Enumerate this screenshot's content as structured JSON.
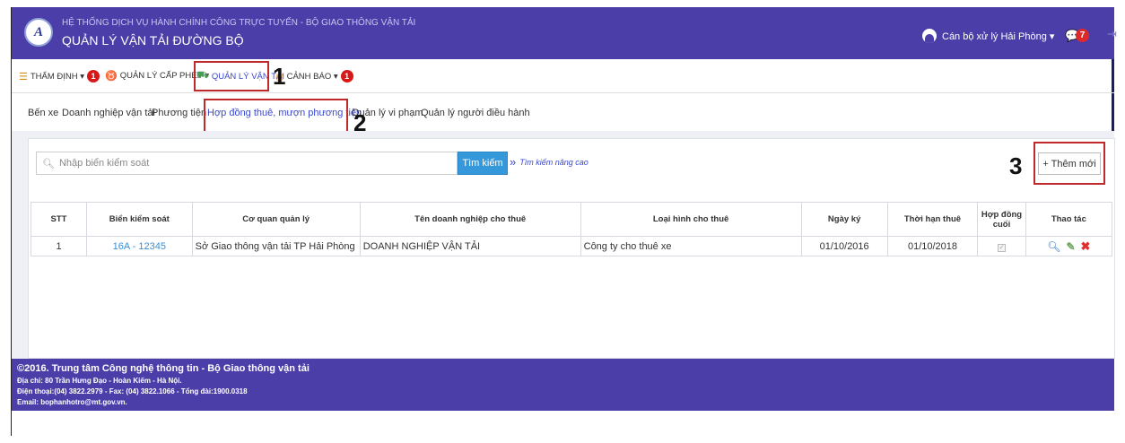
{
  "header": {
    "logo_text": "A",
    "subtitle": "HỆ THỐNG DỊCH VỤ HÀNH CHÍNH CÔNG TRỰC TUYẾN - BỘ GIAO THÔNG VẬN TẢI",
    "title": "QUẢN LÝ VẬN TẢI ĐƯỜNG BỘ",
    "user_label": "Cán bộ xử lý Hải Phòng ▾",
    "notification_count": "7"
  },
  "menu": {
    "items": [
      {
        "label": "THẨM ĐỊNH ▾",
        "badge": "1"
      },
      {
        "label": "QUẢN LÝ CẤP PHÉP ▾"
      },
      {
        "label": "QUẢN LÝ VẬN TẢI"
      },
      {
        "label": "CẢNH BÁO ▾",
        "badge": "1"
      }
    ]
  },
  "submenu": {
    "items": [
      "Bến xe",
      "Doanh nghiệp vận tải",
      "Phương tiện",
      "Hợp đồng thuê, mượn phương tiện",
      "Quản lý vi phạm",
      "Quản lý người điều hành"
    ]
  },
  "annotations": [
    "1",
    "2",
    "3"
  ],
  "toolbar": {
    "search_placeholder": "Nhập biển kiểm soát",
    "search_button": "Tìm kiếm",
    "advanced_chevron": "»",
    "advanced_search": "Tìm kiếm nâng cao",
    "new_button": "+ Thêm mới"
  },
  "table": {
    "headers": [
      "STT",
      "Biển kiểm soát",
      "Cơ quan quản lý",
      "Tên doanh nghiệp cho thuê",
      "Loại hình cho thuê",
      "Ngày ký",
      "Thời hạn thuê",
      "Hợp đồng cuối",
      "Thao tác"
    ],
    "rows": [
      {
        "stt": "1",
        "plate": "16A - 12345",
        "agency": "Sở Giao thông vận tải TP Hải Phòng",
        "company": "DOANH NGHIỆP VẬN TẢI",
        "type": "Công ty cho thuê xe",
        "signed": "01/10/2016",
        "term": "01/10/2018"
      }
    ]
  },
  "footer": {
    "line1": "©2016. Trung tâm Công nghệ thông tin - Bộ Giao thông vận tải",
    "line2": "Địa chỉ: 80 Trần Hưng Đạo - Hoàn Kiếm - Hà Nội.",
    "line3": "Điện thoại:(04) 3822.2979 - Fax: (04) 3822.1066 - Tổng đài:1900.0318",
    "line4": "Email: bophanhotro@mt.gov.vn."
  },
  "colors": {
    "header_bg": "#4b3ea8",
    "annotation_red": "#c0292b",
    "search_button": "#3498db",
    "link": "#3a8fd8"
  }
}
